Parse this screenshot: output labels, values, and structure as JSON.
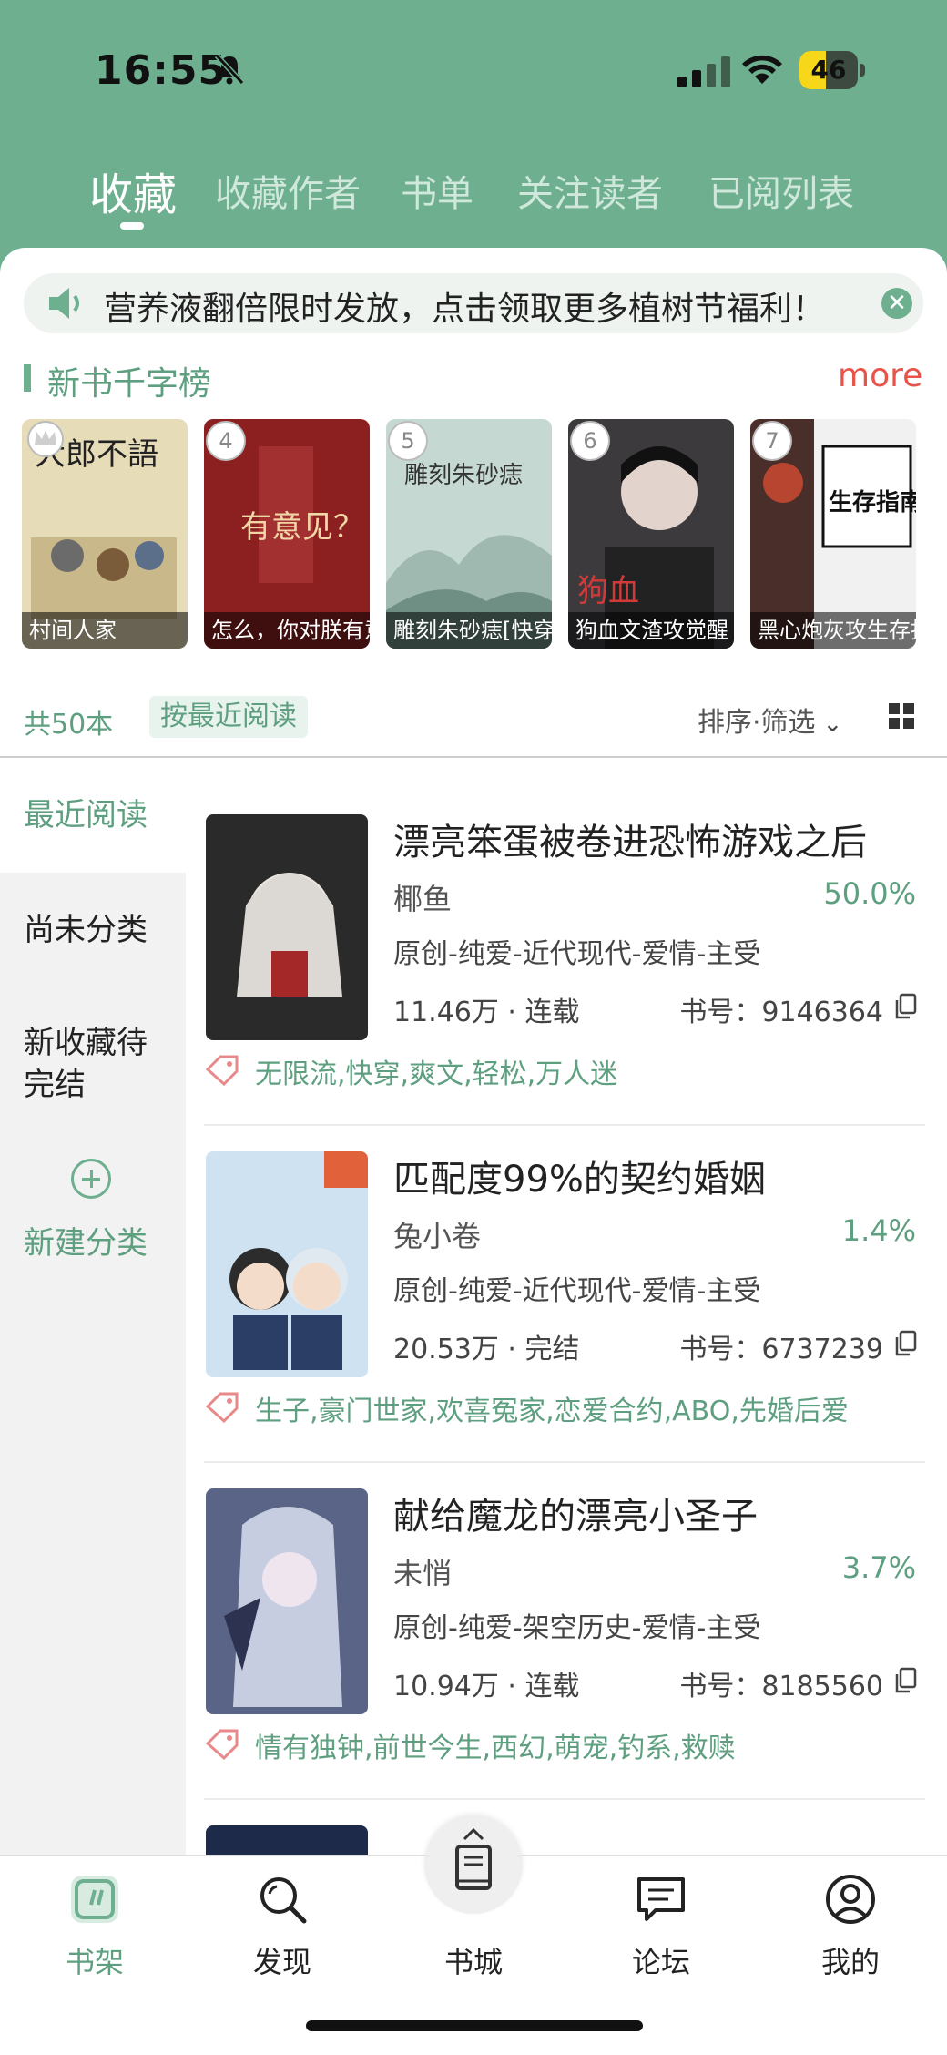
{
  "status_bar": {
    "time": "16:55",
    "battery": "46",
    "battery_level": 0.46
  },
  "top_tabs": [
    {
      "label": "收藏",
      "active": true
    },
    {
      "label": "收藏作者"
    },
    {
      "label": "书单"
    },
    {
      "label": "关注读者"
    },
    {
      "label": "已阅列表"
    }
  ],
  "notice": {
    "text": "营养液翻倍限时发放，点击领取更多植树节福利！"
  },
  "ranking": {
    "title": "新书千字榜",
    "more": "more",
    "items": [
      {
        "rank": "",
        "title": "村间人家",
        "cover_text": "大郎不語",
        "color": "#e7dcb8"
      },
      {
        "rank": "4",
        "title": "怎么，你对朕有意见",
        "cover_text": "有意见？",
        "color": "#8c1f1f"
      },
      {
        "rank": "5",
        "title": "雕刻朱砂痣[快穿]",
        "cover_text": "雕刻朱砂痣",
        "color": "#9fb9b1"
      },
      {
        "rank": "6",
        "title": "狗血文渣攻觉醒",
        "cover_text": "狗血",
        "color": "#3d3a3e"
      },
      {
        "rank": "7",
        "title": "黑心炮灰攻生存指南",
        "cover_text": "生存指南",
        "color": "#4a2e2a"
      }
    ]
  },
  "list_meta": {
    "count": "共50本",
    "sort_chip": "按最近阅读",
    "filter": "排序·筛选"
  },
  "sidebar": {
    "items": [
      {
        "label": "最近阅读",
        "active": true
      },
      {
        "label": "尚未分类"
      },
      {
        "label": "新收藏待\n完结"
      }
    ],
    "add_label": "新建分类"
  },
  "books": [
    {
      "title": "漂亮笨蛋被卷进恐怖游戏之后",
      "author": "椰鱼",
      "progress": "50.0%",
      "genre": "原创-纯爱-近代现代-爱情-主受",
      "words": "11.46万 · 连载",
      "book_id": "书号：9146364",
      "tags": "无限流,快穿,爽文,轻松,万人迷",
      "cover_color": "#2a2a2a"
    },
    {
      "title": "匹配度99%的契约婚姻",
      "author": "兔小卷",
      "progress": "1.4%",
      "genre": "原创-纯爱-近代现代-爱情-主受",
      "words": "20.53万 · 完结",
      "book_id": "书号：6737239",
      "tags": "生子,豪门世家,欢喜冤家,恋爱合约,ABO,先婚后爱",
      "cover_color": "#cfe2f2"
    },
    {
      "title": "献给魔龙的漂亮小圣子",
      "author": "未悄",
      "progress": "3.7%",
      "genre": "原创-纯爱-架空历史-爱情-主受",
      "words": "10.94万 · 连载",
      "book_id": "书号：8185560",
      "tags": "情有独钟,前世今生,西幻,萌宠,钓系,救赎",
      "cover_color": "#5a6486"
    }
  ],
  "bottom_nav": [
    {
      "label": "书架",
      "icon": "bookshelf-icon",
      "active": true
    },
    {
      "label": "发现",
      "icon": "search-icon"
    },
    {
      "label": "书城",
      "icon": "book-icon"
    },
    {
      "label": "论坛",
      "icon": "chat-icon"
    },
    {
      "label": "我的",
      "icon": "profile-icon"
    }
  ],
  "colors": {
    "accent": "#6daf8f",
    "accent_text": "#5e9f80",
    "more": "#e8544a"
  }
}
